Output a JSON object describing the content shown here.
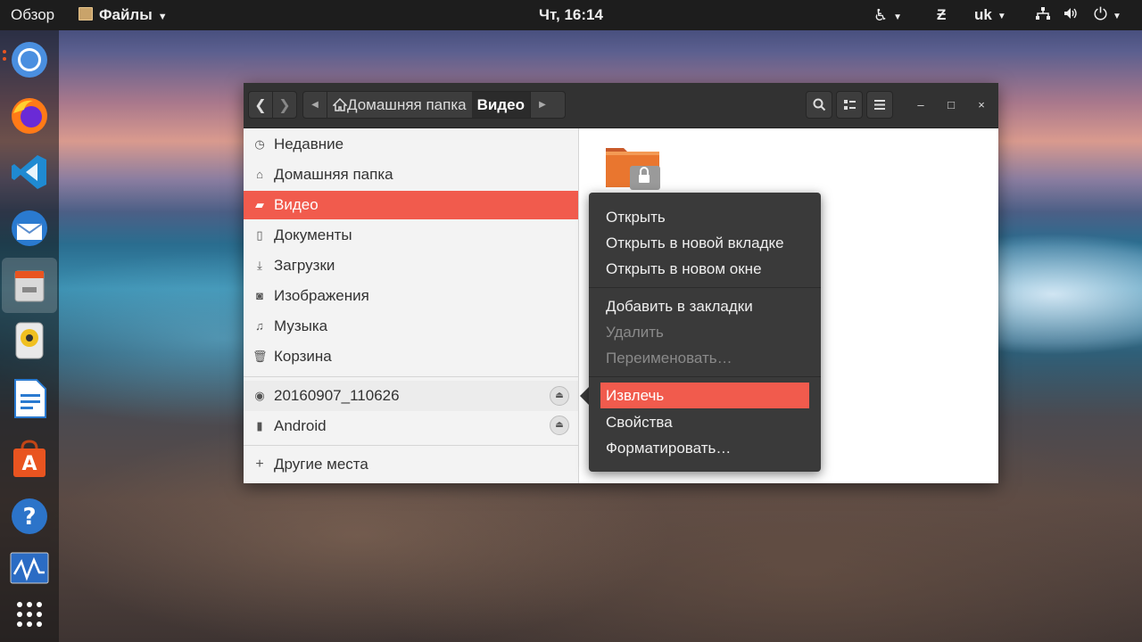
{
  "topbar": {
    "overview": "Обзор",
    "app_menu": "Файлы",
    "clock": "Чт, 16:14",
    "language": "uk"
  },
  "dock": {
    "items": [
      "chromium-browser",
      "firefox",
      "vscode",
      "thunderbird",
      "files",
      "rhythmbox",
      "libreoffice-writer",
      "ubuntu-software",
      "help",
      "system-monitor",
      "show-applications"
    ]
  },
  "window": {
    "breadcrumbs": {
      "home": "Домашняя папка",
      "current": "Видео"
    },
    "sidebar": {
      "places": [
        {
          "label": "Недавние",
          "icon": "clock-icon"
        },
        {
          "label": "Домашняя папка",
          "icon": "home-icon"
        },
        {
          "label": "Видео",
          "icon": "video-icon",
          "selected": true
        },
        {
          "label": "Документы",
          "icon": "document-icon"
        },
        {
          "label": "Загрузки",
          "icon": "download-icon"
        },
        {
          "label": "Изображения",
          "icon": "camera-icon"
        },
        {
          "label": "Музыка",
          "icon": "music-icon"
        },
        {
          "label": "Корзина",
          "icon": "trash-icon"
        }
      ],
      "devices": [
        {
          "label": "20160907_110626",
          "icon": "disc-icon"
        },
        {
          "label": "Android",
          "icon": "phone-icon"
        }
      ],
      "other": {
        "label": "Другие места",
        "icon": "plus-icon"
      }
    }
  },
  "context_menu": {
    "items": [
      {
        "label": "Открыть",
        "state": "enabled"
      },
      {
        "label": "Открыть в новой вкладке",
        "state": "enabled"
      },
      {
        "label": "Открыть в новом окне",
        "state": "enabled"
      },
      {
        "label": "Добавить в закладки",
        "state": "enabled"
      },
      {
        "label": "Удалить",
        "state": "disabled"
      },
      {
        "label": "Переименовать…",
        "state": "disabled"
      },
      {
        "label": "Извлечь",
        "state": "highlighted"
      },
      {
        "label": "Свойства",
        "state": "enabled"
      },
      {
        "label": "Форматировать…",
        "state": "enabled"
      }
    ]
  },
  "colors": {
    "accent": "#f15b4d",
    "ubuntu_orange": "#e95420",
    "headerbar": "#323232",
    "menu_bg": "#3a3a3a"
  }
}
